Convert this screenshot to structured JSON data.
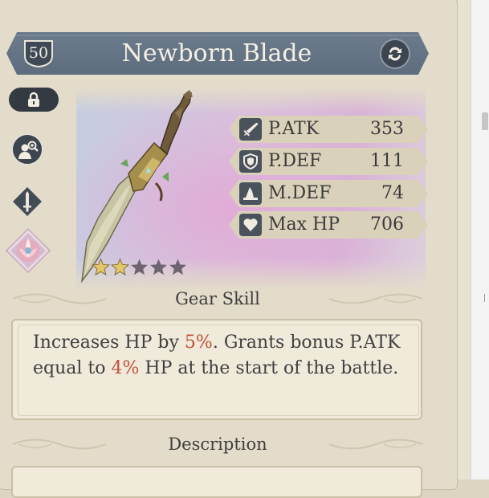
{
  "gear": {
    "level": "50",
    "name": "Newborn Blade",
    "stars_filled": 2,
    "stars_total": 5
  },
  "stats": [
    {
      "icon": "sword-icon",
      "label": "P.ATK",
      "value": "353"
    },
    {
      "icon": "shield-icon",
      "label": "P.DEF",
      "value": "111"
    },
    {
      "icon": "wizard-hat-icon",
      "label": "M.DEF",
      "value": "74"
    },
    {
      "icon": "heart-icon",
      "label": "Max HP",
      "value": "706"
    }
  ],
  "skill": {
    "header": "Gear Skill",
    "text_1": "Increases HP by ",
    "value_1": "5%",
    "text_2": ". Grants bonus P.ATK equal to ",
    "value_2": "4%",
    "text_3": " HP at the start of the battle."
  },
  "description": {
    "header": "Description"
  },
  "colors": {
    "title_bar": "#5d6d7e",
    "highlight": "#c0513b",
    "panel": "#ddd5c2",
    "star_filled": "#e6c66a",
    "star_empty": "#6e6470"
  }
}
